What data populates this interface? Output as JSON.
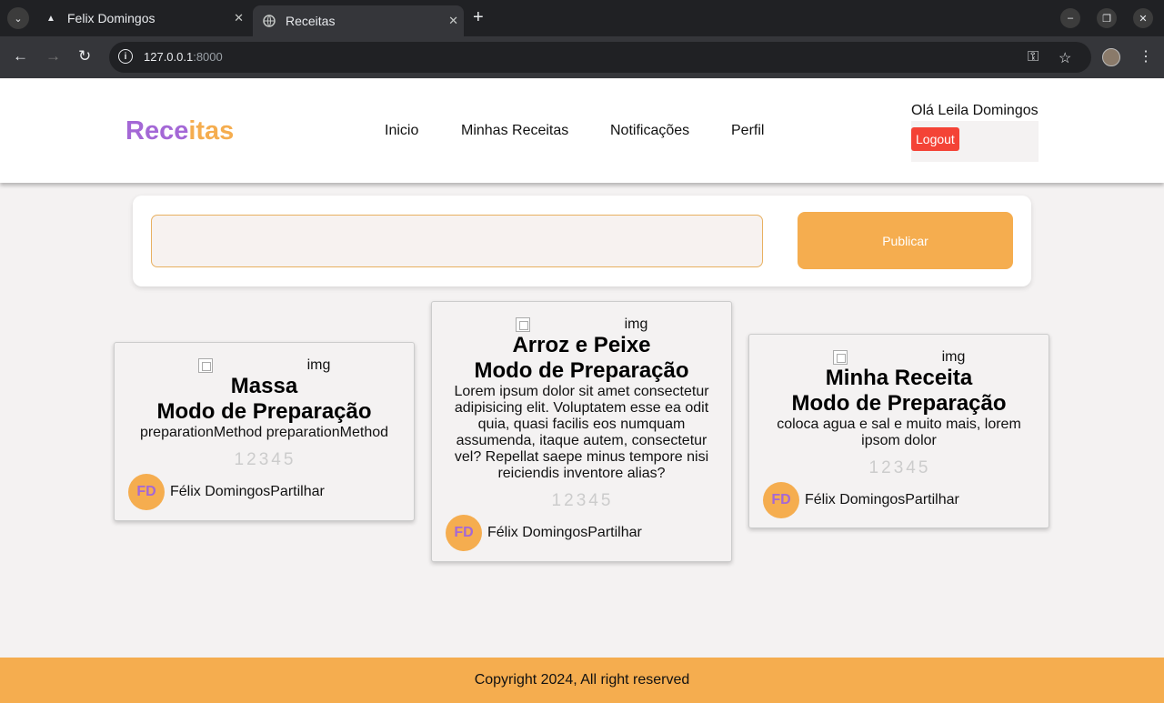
{
  "browser": {
    "tabs": [
      {
        "title": "Felix Domingos",
        "icon": "triangle-favicon-icon"
      },
      {
        "title": "Receitas",
        "icon": "globe-icon"
      }
    ],
    "url_host": "127.0.0.1",
    "url_port": ":8000"
  },
  "header": {
    "logo_part1": "Rece",
    "logo_part2": "itas",
    "nav": [
      "Inicio",
      "Minhas Receitas",
      "Notificações",
      "Perfil"
    ],
    "greeting": "Olá Leila Domingos",
    "logout_label": "Logout"
  },
  "publish": {
    "input_value": "",
    "button_label": "Publicar"
  },
  "cards": [
    {
      "img_alt": "img",
      "name": "Massa",
      "subtitle": "Modo de Preparação",
      "description": "preparationMethod preparationMethod",
      "stars": [
        "1",
        "2",
        "3",
        "4",
        "5"
      ],
      "avatar": "FD",
      "author_line": "Félix DomingosPartilhar"
    },
    {
      "img_alt": "img",
      "name": "Arroz e Peixe",
      "subtitle": "Modo de Preparação",
      "description": "Lorem ipsum dolor sit amet consectetur adipisicing elit. Voluptatem esse ea odit quia, quasi facilis eos numquam assumenda, itaque autem, consectetur vel? Repellat saepe minus tempore nisi reiciendis inventore alias?",
      "stars": [
        "1",
        "2",
        "3",
        "4",
        "5"
      ],
      "avatar": "FD",
      "author_line": "Félix DomingosPartilhar"
    },
    {
      "img_alt": "img",
      "name": "Minha Receita",
      "subtitle": "Modo de Preparação",
      "description": "coloca agua e sal e muito mais, lorem ipsom dolor",
      "stars": [
        "1",
        "2",
        "3",
        "4",
        "5"
      ],
      "avatar": "FD",
      "author_line": "Félix DomingosPartilhar"
    }
  ],
  "footer": {
    "text": "Copyright 2024, All right reserved"
  },
  "colors": {
    "brand_purple": "#a468d6",
    "brand_orange": "#f5ad4f",
    "logout_red": "#f44336"
  }
}
